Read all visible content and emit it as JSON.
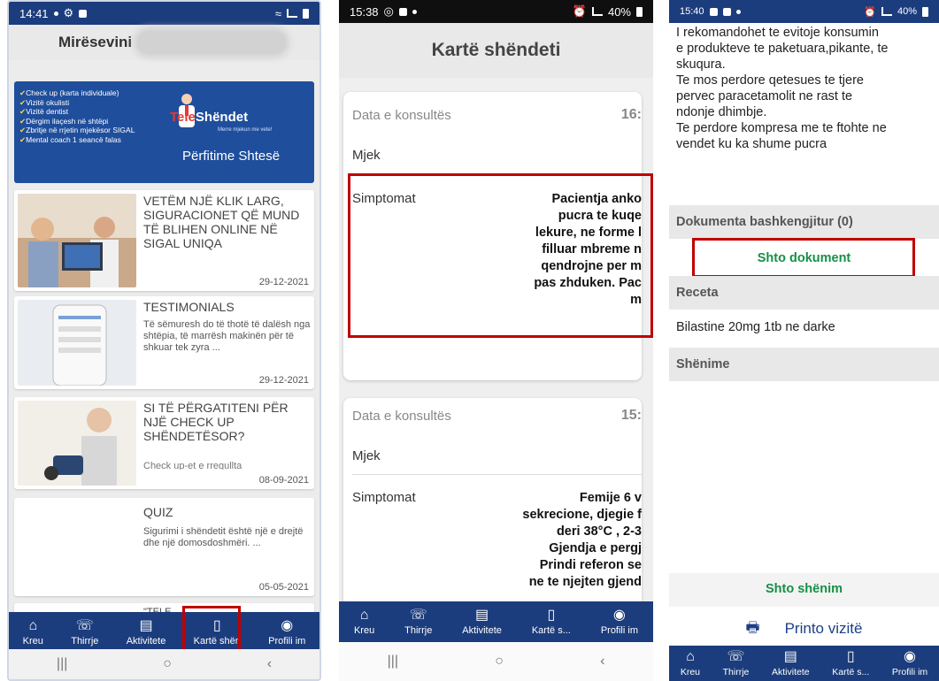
{
  "phone1": {
    "status_time": "14:41",
    "welcome": "Mirësevini",
    "banner": {
      "items": [
        "Check up (karta individuale)",
        "Vizitë okulisti",
        "Vizitë dentist",
        "Dërgim ilaçesh në shtëpi",
        "Zbritje në rrjetin mjekësor SIGAL",
        "Mental coach 1 seancë falas"
      ],
      "logo_a": "Tele",
      "logo_b": "Shëndet",
      "slogan": "Merre mjekun me vete!",
      "benefit": "Përfitime Shtesë"
    },
    "news": [
      {
        "title": "VETËM NJË KLIK LARG, SIGURACIONET QË MUND TË BLIHEN ONLINE NË SIGAL UNIQA",
        "snippet": "",
        "date": "29-12-2021"
      },
      {
        "title": "TESTIMONIALS",
        "snippet": "Të sëmuresh do të thotë të dalësh nga shtëpia, të marrësh makinën për të shkuar tek zyra ...",
        "date": "29-12-2021"
      },
      {
        "title": "SI TË PËRGATITENI PËR NJË CHECK UP SHËNDETËSOR?",
        "snippet": "Check up-et e rregullta",
        "date": "08-09-2021"
      },
      {
        "title": "QUIZ",
        "snippet": "Sigurimi i shëndetit është një e drejtë dhe një domosdoshmëri. ...",
        "date": "05-05-2021"
      }
    ],
    "peek_title": "\"TELE",
    "nav": [
      "Kreu",
      "Thirrje",
      "Aktivitete",
      "Kartë shën",
      "Profili im"
    ]
  },
  "phone2": {
    "status_time": "15:38",
    "battery": "40%",
    "title": "Kartë shëndeti",
    "card1": {
      "date_label": "Data e konsultës",
      "date_value": "16:",
      "doctor_label": "Mjek",
      "symptom_label": "Simptomat",
      "symptom_lines": [
        "Pacientja anko",
        "pucra te kuqe",
        "lekure, ne forme l",
        "filluar mbreme n",
        "qendrojne per m",
        "pas zhduken. Pac",
        "m"
      ]
    },
    "card2": {
      "date_label": "Data e konsultës",
      "date_value": "15:",
      "doctor_label": "Mjek",
      "symptom_label": "Simptomat",
      "symptom_lines": [
        "Femije 6 v",
        "sekrecione, djegie f",
        "deri 38°C , 2-3",
        "Gjendja e pergj",
        "Prindi referon se",
        "ne te njejten gjend"
      ]
    },
    "nav": [
      "Kreu",
      "Thirrje",
      "Aktivitete",
      "Kartë s...",
      "Profili im"
    ]
  },
  "phone3": {
    "status_time": "15:40",
    "battery": "40%",
    "text_lines": [
      "I rekomandohet te evitoje konsumin",
      "e produkteve te paketuara,pikante, te",
      "skuqura.",
      "Te mos perdore qetesues te tjere",
      "pervec paracetamolit ne rast te",
      "ndonje dhimbje.",
      "Te perdore kompresa me te ftohte ne",
      "vendet ku ka shume pucra"
    ],
    "attachments": "Dokumenta bashkengjitur (0)",
    "add_document": "Shto dokument",
    "prescription": "Receta",
    "prescription_value": "Bilastine 20mg 1tb ne darke",
    "notes": "Shënime",
    "add_note": "Shto shënim",
    "print": "Printo vizitë",
    "nav": [
      "Kreu",
      "Thirrje",
      "Aktivitete",
      "Kartë s...",
      "Profili im"
    ]
  },
  "colors": {
    "navy": "#1c3d7d",
    "green": "#159046",
    "highlight": "#c00000"
  }
}
